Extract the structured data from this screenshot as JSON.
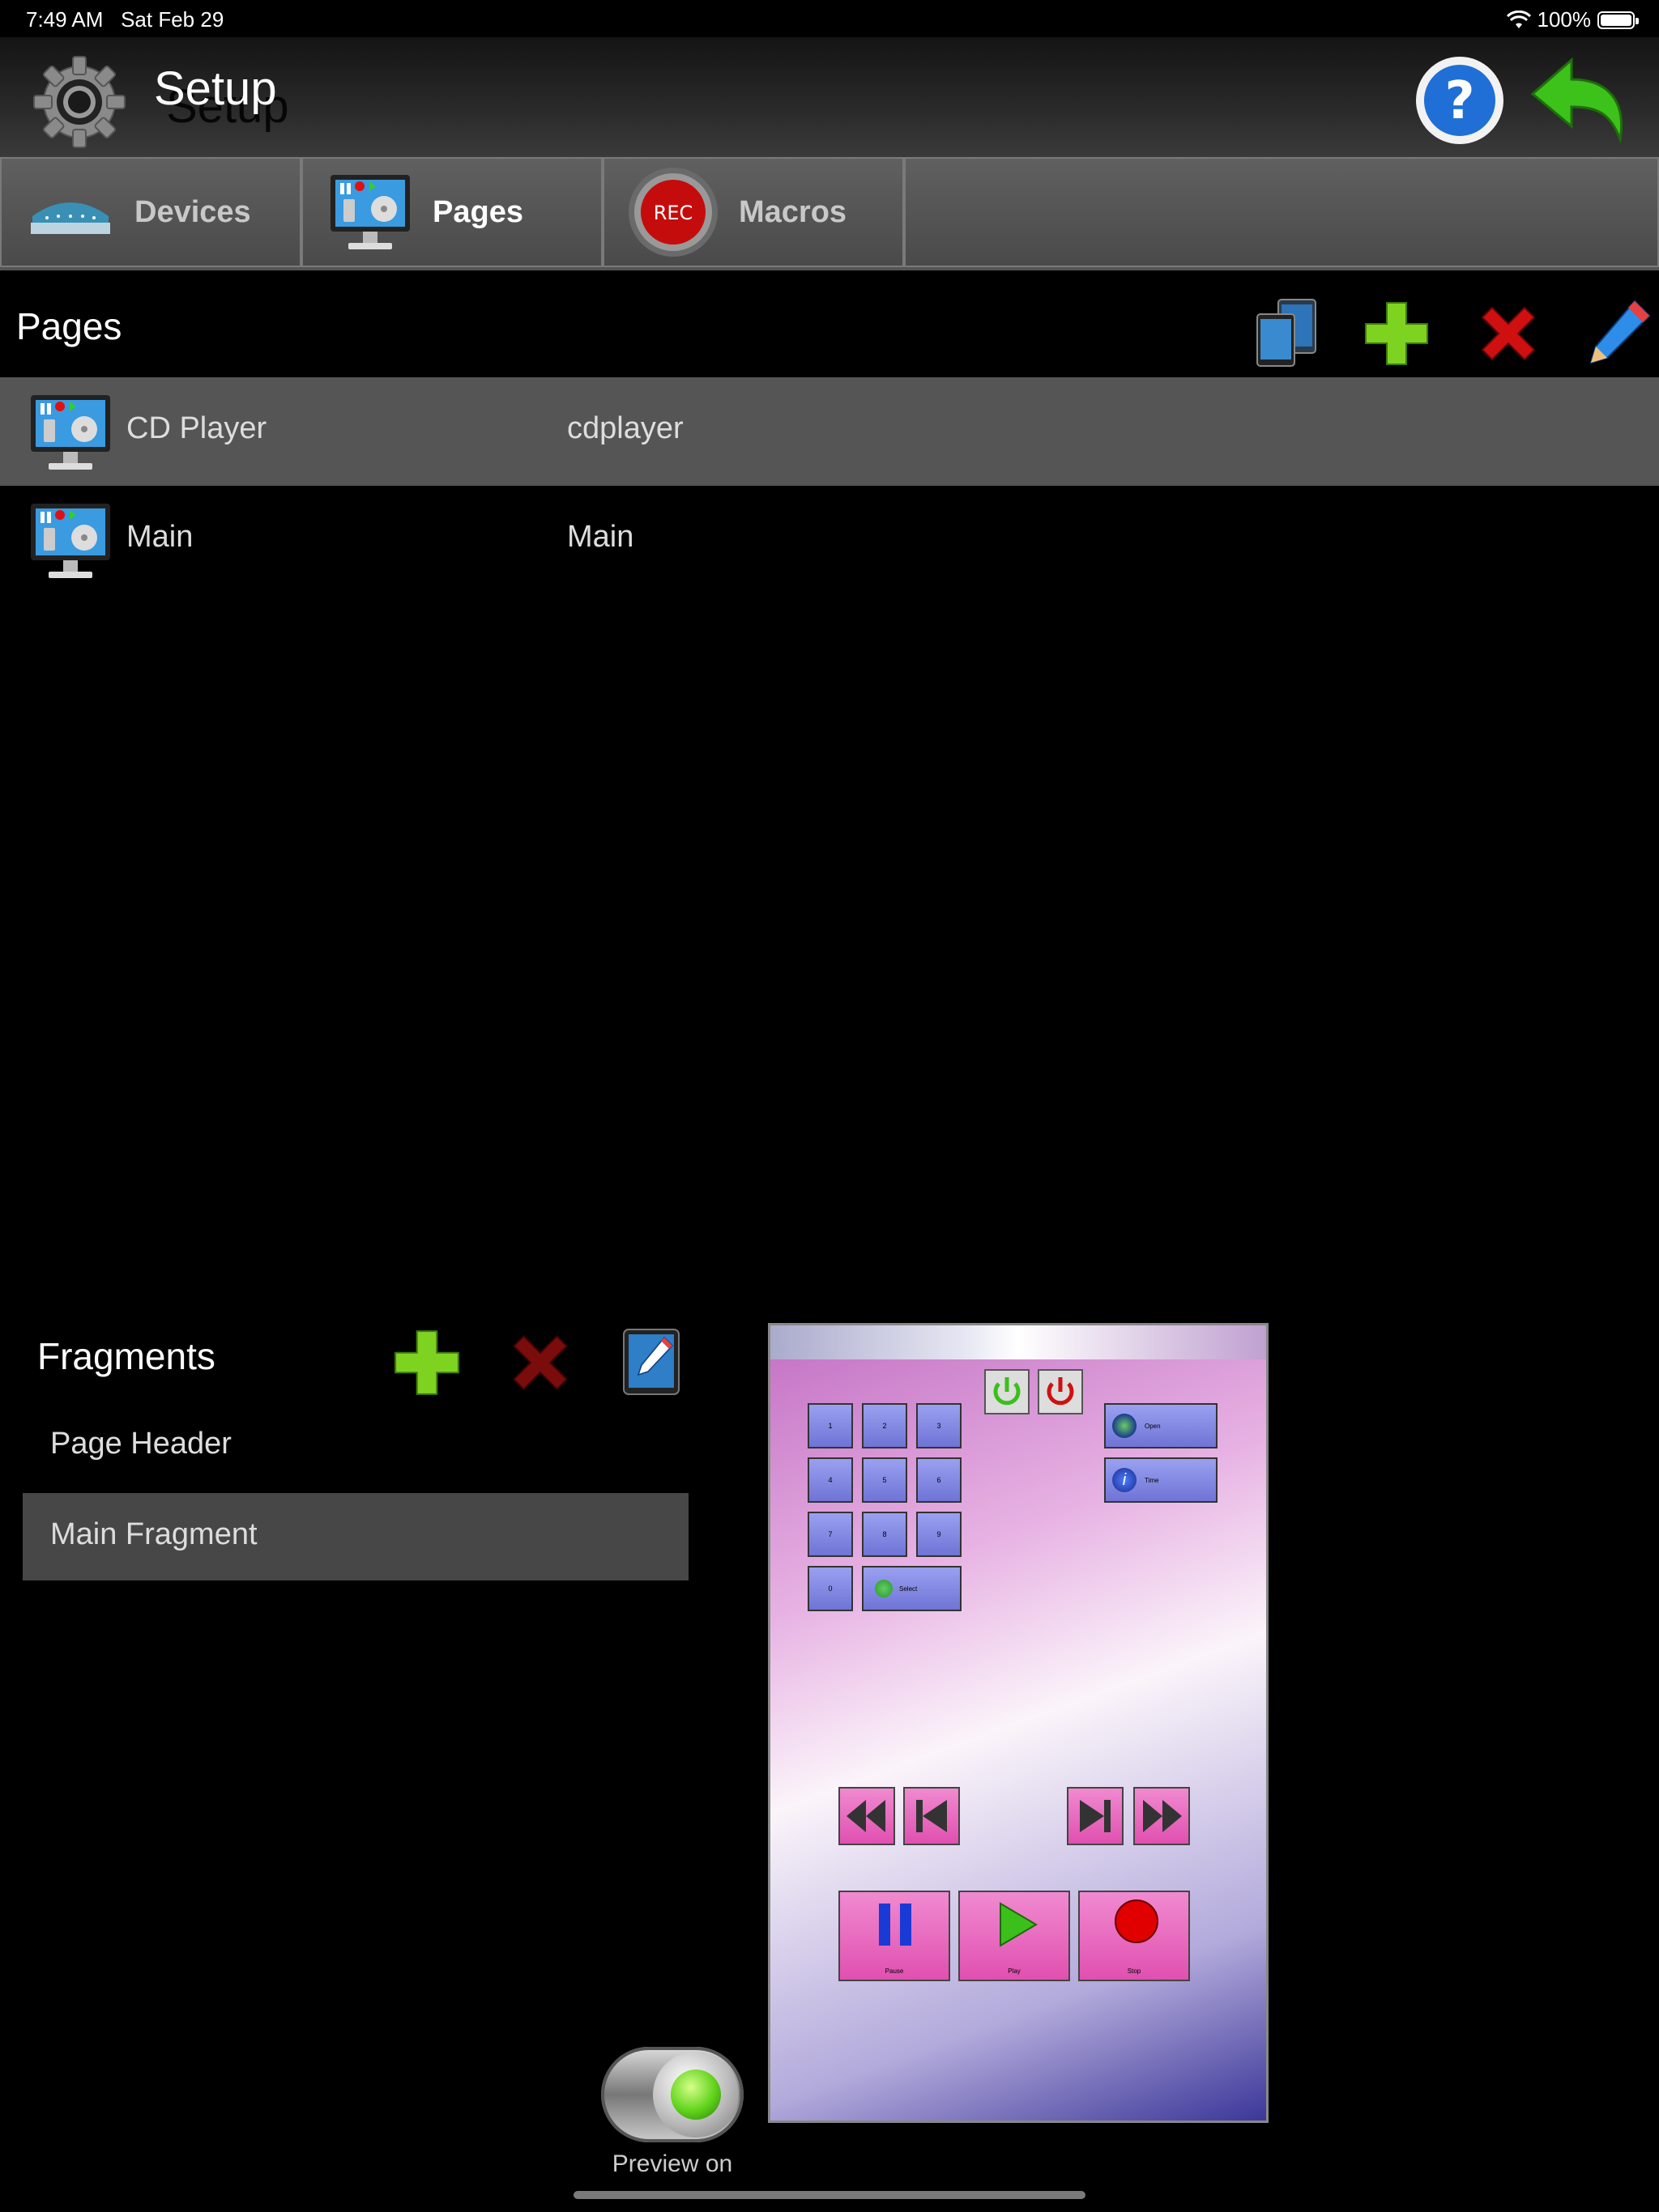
{
  "status": {
    "time": "7:49 AM",
    "date": "Sat Feb 29",
    "battery": "100%",
    "battery_level": 1.0
  },
  "header": {
    "title": "Setup",
    "title_shadow": "Setup"
  },
  "tabs": [
    {
      "label": "Devices",
      "icon": "router-icon"
    },
    {
      "label": "Pages",
      "icon": "monitor-remote-icon",
      "active": true
    },
    {
      "label": "Macros",
      "icon": "rec-icon",
      "icon_text": "REC"
    }
  ],
  "pages": {
    "title": "Pages",
    "items": [
      {
        "name": "CD Player",
        "file": "cdplayer",
        "selected": true
      },
      {
        "name": "Main",
        "file": "Main",
        "selected": false
      }
    ]
  },
  "fragments": {
    "title": "Fragments",
    "items": [
      {
        "name": "Page Header",
        "selected": false
      },
      {
        "name": "Main Fragment",
        "selected": true
      }
    ]
  },
  "preview": {
    "keypad": [
      "1",
      "2",
      "3",
      "4",
      "5",
      "6",
      "7",
      "8",
      "9",
      "0"
    ],
    "select_label": "Select",
    "open_label": "Open",
    "time_label": "Time",
    "pause_label": "Pause",
    "play_label": "Play",
    "stop_label": "Stop"
  },
  "toggle": {
    "label": "Preview on",
    "on": true
  },
  "colors": {
    "accent_green": "#5fd21a",
    "delete_red": "#d01010",
    "selected_row": "#555555"
  }
}
